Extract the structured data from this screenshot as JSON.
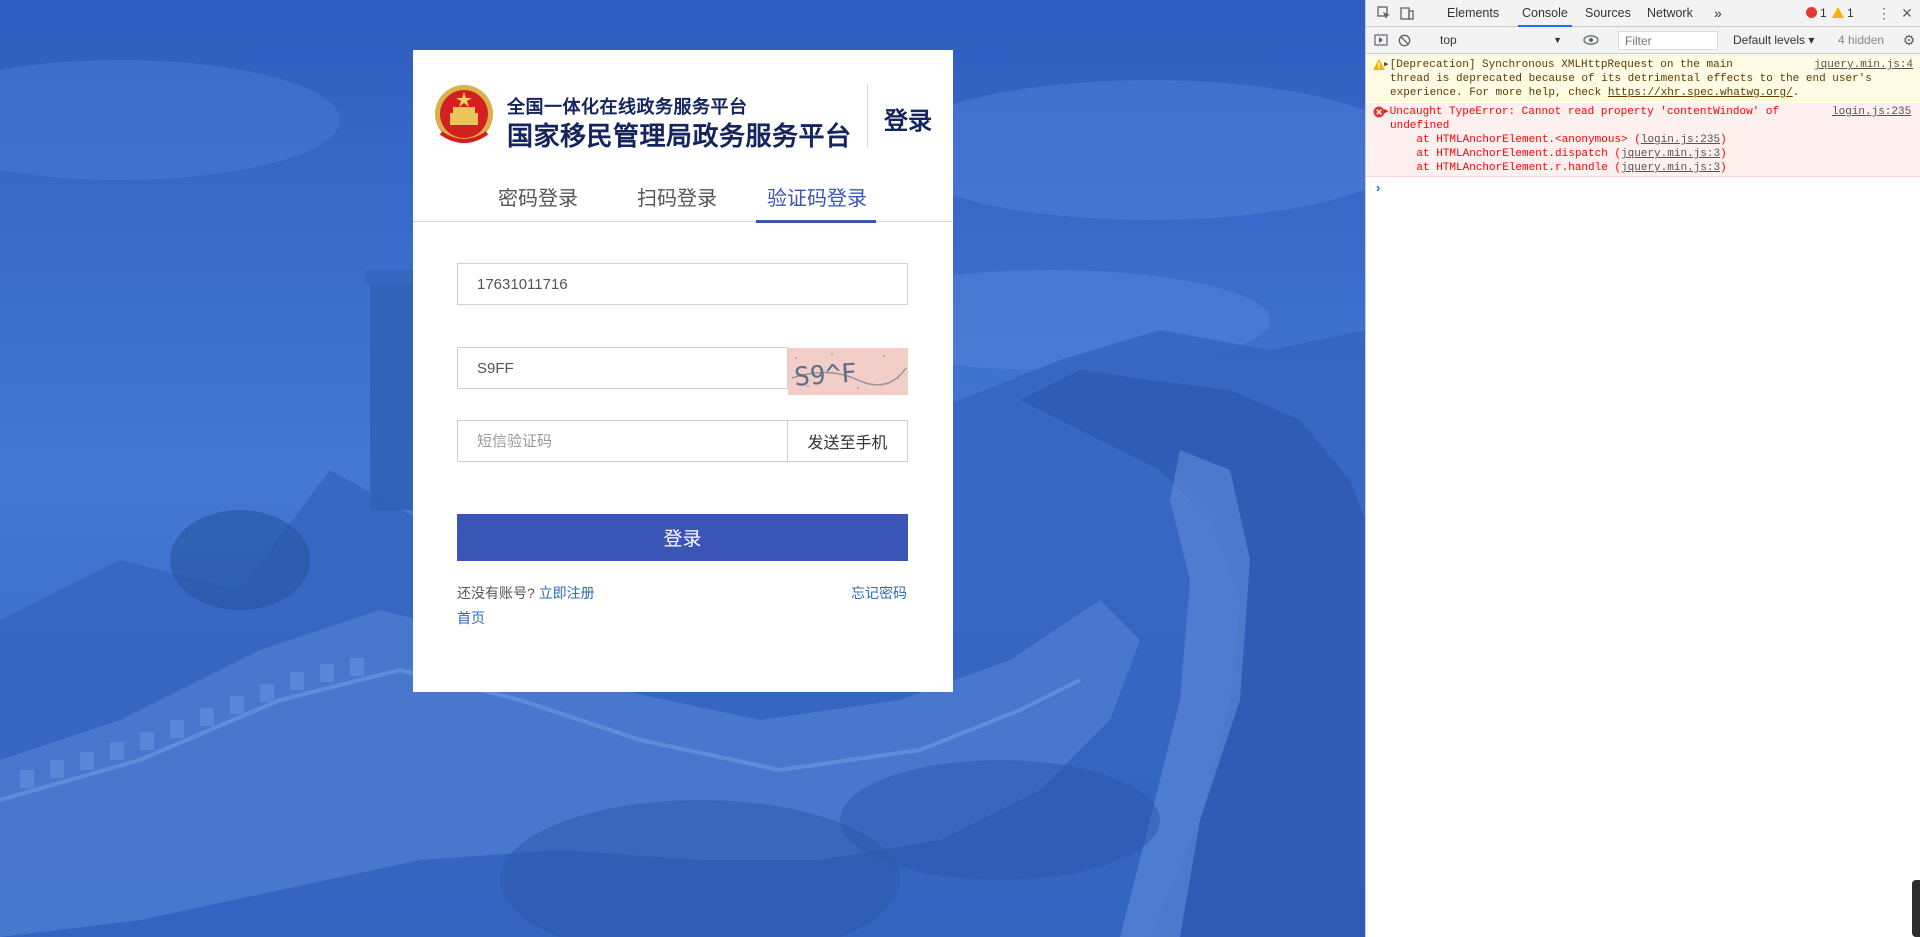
{
  "login": {
    "platform_small": "全国一体化在线政务服务平台",
    "platform_big": "国家移民管理局政务服务平台",
    "header_login": "登录",
    "tabs": [
      {
        "label": "密码登录",
        "active": false
      },
      {
        "label": "扫码登录",
        "active": false
      },
      {
        "label": "验证码登录",
        "active": true
      }
    ],
    "phone_value": "17631011716",
    "captcha_value": "S9FF",
    "captcha_image_text": "S9^F",
    "sms_placeholder": "短信验证码",
    "send_button": "发送至手机",
    "submit_button": "登录",
    "no_account_text": "还没有账号?",
    "register_link": "立即注册",
    "forgot_link": "忘记密码",
    "home_link": "首页"
  },
  "devtools": {
    "tabs": [
      {
        "label": "Elements",
        "active": false
      },
      {
        "label": "Console",
        "active": true
      },
      {
        "label": "Sources",
        "active": false
      },
      {
        "label": "Network",
        "active": false
      }
    ],
    "more_tabs": "»",
    "error_count": "1",
    "warning_count": "1",
    "context": "top",
    "filter_placeholder": "Filter",
    "levels": "Default levels ▾",
    "hidden": "4 hidden",
    "warning": {
      "line1": "▸[Deprecation] Synchronous XMLHttpRequest on the main",
      "line2": "thread is deprecated because of its detrimental effects to the end user's",
      "line3": "experience. For more help, check ",
      "link": "https://xhr.spec.whatwg.org/",
      "line3_end": ".",
      "source": "jquery.min.js:4"
    },
    "error": {
      "line1": "▸Uncaught TypeError: Cannot read property 'contentWindow' of",
      "line2": "undefined",
      "stack1_pre": "    at HTMLAnchorElement.<anonymous> (",
      "stack1_src": "login.js:235",
      "stack2_pre": "    at HTMLAnchorElement.dispatch (",
      "stack2_src": "jquery.min.js:3",
      "stack3_pre": "    at HTMLAnchorElement.r.handle (",
      "stack3_src": "jquery.min.js:3",
      "close": ")",
      "source": "login.js:235"
    },
    "prompt": "›"
  },
  "colors": {
    "accent": "#3b55b7",
    "title": "#14245c",
    "link": "#2d6bb5",
    "background": "#3a69c6"
  }
}
